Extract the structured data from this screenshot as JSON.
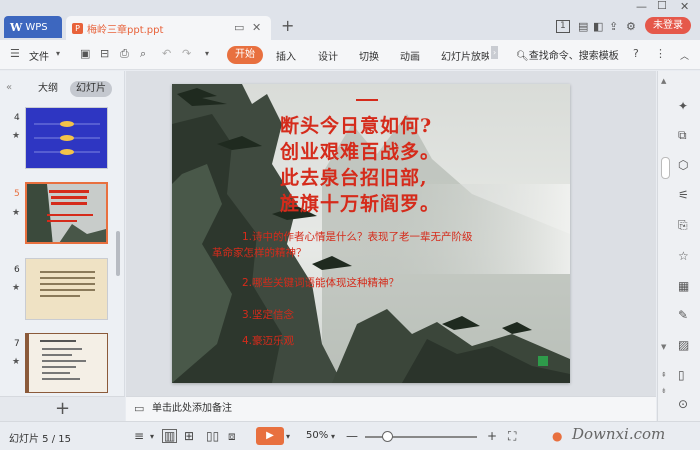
{
  "titlebar": {
    "app_label": "WPS",
    "doc_tab_title": "梅岭三章ppt.ppt",
    "login_label": "未登录",
    "badge_num": "1"
  },
  "menu": {
    "file_label": "文件",
    "tabs": [
      "开始",
      "插入",
      "设计",
      "切换",
      "动画",
      "幻灯片放映"
    ],
    "search_placeholder": "查找命令、搜索模板"
  },
  "leftpanel": {
    "tab_outline": "大纲",
    "tab_slides": "幻灯片",
    "thumb_numbers": [
      "4",
      "5",
      "6",
      "7"
    ],
    "selected_index": 5
  },
  "slide": {
    "heading_mark": "一",
    "poem_lines": [
      "断头今日意如何?",
      "创业艰难百战多。",
      "此去泉台招旧部,",
      "旌旗十万斩阎罗。"
    ],
    "questions": [
      "1.诗中的作者心情是什么？表现了老一辈无产阶级",
      "革命家怎样的精神？",
      "2.哪些关键词语能体现这种精神？",
      "3.坚定信念",
      "4.豪迈乐观"
    ]
  },
  "notes": {
    "placeholder": "单击此处添加备注"
  },
  "status": {
    "slide_counter": "幻灯片 5 / 15",
    "zoom_level": "50%",
    "zoom_fraction": 0.2,
    "watermark": "Downxi.com"
  },
  "colors": {
    "accent": "#e8703f",
    "wps_blue": "#3d67bf",
    "login_red": "#e5584a",
    "slide_text_red": "#d52b1b"
  }
}
